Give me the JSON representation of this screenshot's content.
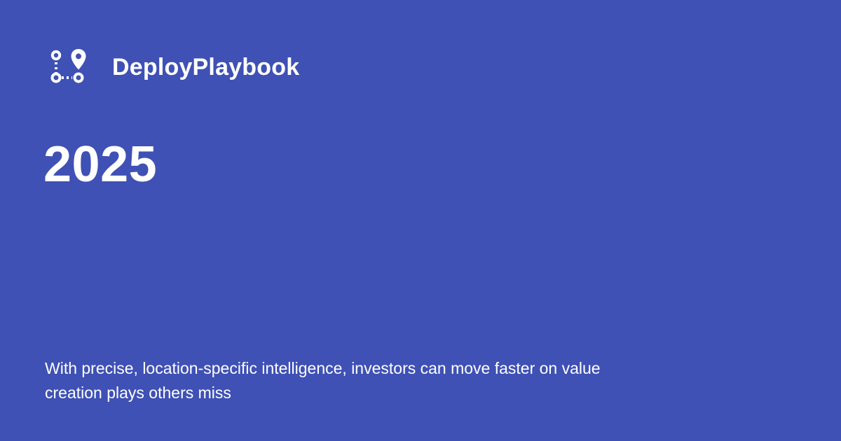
{
  "brand": {
    "name": "DeployPlaybook",
    "icon": "route-pins-icon"
  },
  "headline": {
    "year": "2025"
  },
  "description": {
    "text": "With precise, location-specific intelligence, investors can move faster on value creation plays others miss"
  },
  "colors": {
    "background": "#3f51b5",
    "text": "#ffffff"
  }
}
